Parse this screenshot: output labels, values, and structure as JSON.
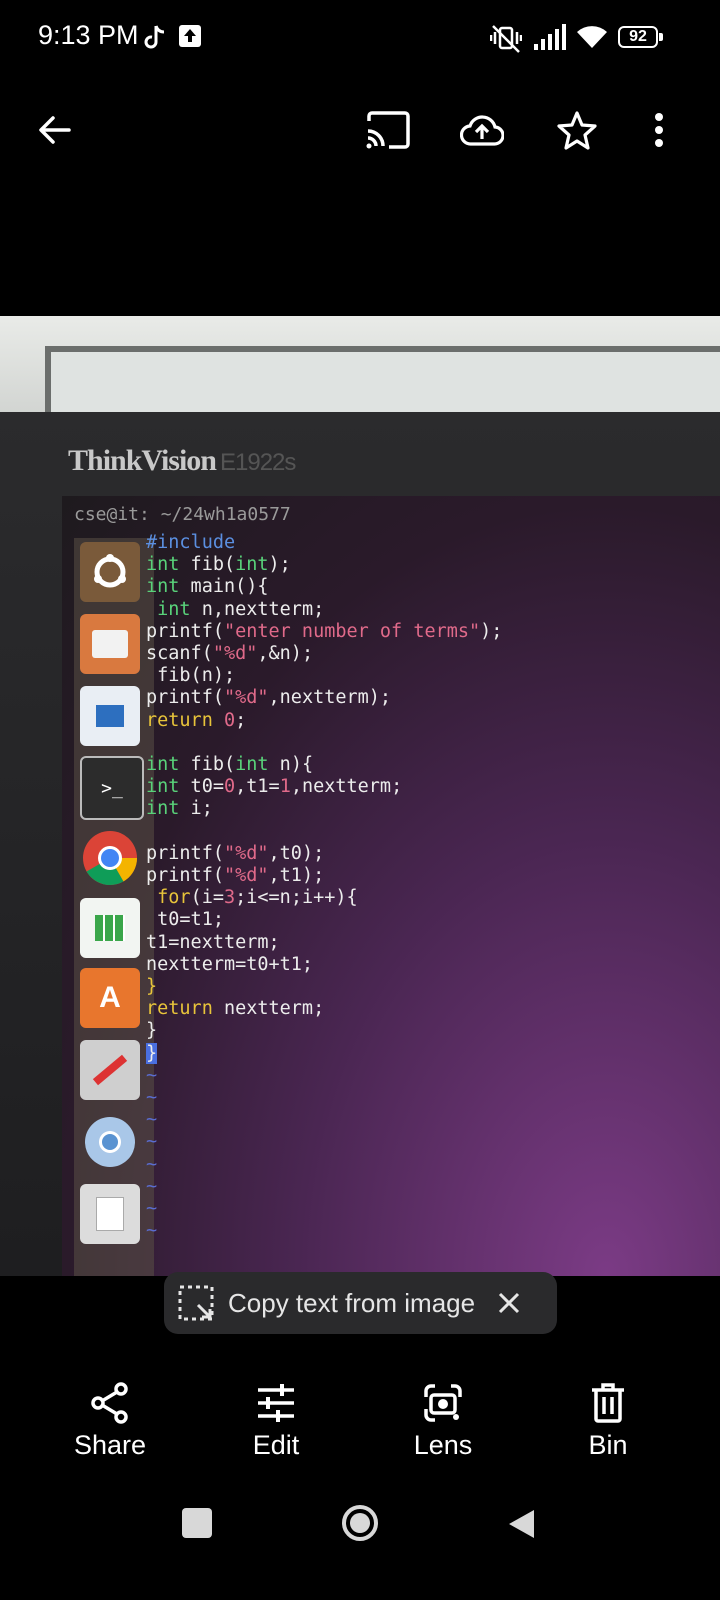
{
  "status_bar": {
    "time": "9:13 PM",
    "battery": "92"
  },
  "photo": {
    "monitor_brand": "ThinkVision",
    "monitor_model": "E1922s",
    "terminal_title": "cse@it: ~/24wh1a0577"
  },
  "chip": {
    "label": "Copy text from image"
  },
  "actions": [
    {
      "label": "Share"
    },
    {
      "label": "Edit"
    },
    {
      "label": "Lens"
    },
    {
      "label": "Bin"
    }
  ]
}
